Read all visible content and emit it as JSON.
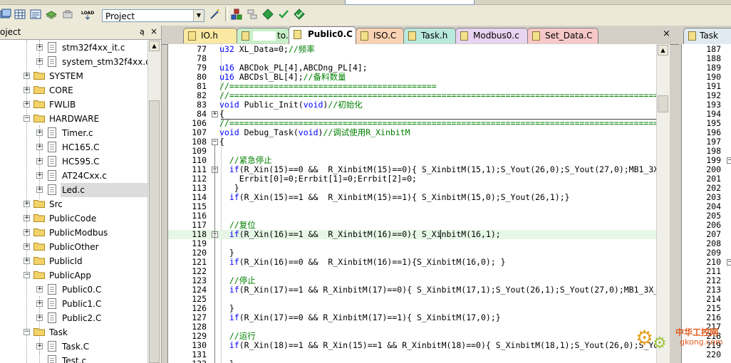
{
  "toolbar": {
    "project_select": "Project"
  },
  "project_panel": {
    "title": "oject",
    "pin": "ą",
    "close": "×",
    "items": [
      {
        "label": "stm32f4xx_it.c",
        "type": "file",
        "level": 3,
        "expander": "+"
      },
      {
        "label": "system_stm32f4xx.c",
        "type": "file",
        "level": 3,
        "expander": "+"
      },
      {
        "label": "SYSTEM",
        "type": "folder",
        "level": 2,
        "expander": "+"
      },
      {
        "label": "CORE",
        "type": "folder",
        "level": 2,
        "expander": "+"
      },
      {
        "label": "FWLIB",
        "type": "folder",
        "level": 2,
        "expander": "+"
      },
      {
        "label": "HARDWARE",
        "type": "folder",
        "level": 2,
        "expander": "−"
      },
      {
        "label": "Timer.c",
        "type": "file",
        "level": 3,
        "expander": "+"
      },
      {
        "label": "HC165.C",
        "type": "file",
        "level": 3,
        "expander": "+"
      },
      {
        "label": "HC595.C",
        "type": "file",
        "level": 3,
        "expander": "+"
      },
      {
        "label": "AT24Cxx.c",
        "type": "file",
        "level": 3,
        "expander": "+"
      },
      {
        "label": "Led.c",
        "type": "file",
        "level": 3,
        "expander": "+",
        "selected": true
      },
      {
        "label": "Src",
        "type": "folder",
        "level": 2,
        "expander": "+"
      },
      {
        "label": "PublicCode",
        "type": "folder",
        "level": 2,
        "expander": "+"
      },
      {
        "label": "PublicModbus",
        "type": "folder",
        "level": 2,
        "expander": "+"
      },
      {
        "label": "PublicOther",
        "type": "folder",
        "level": 2,
        "expander": "+"
      },
      {
        "label": "PublicId",
        "type": "folder",
        "level": 2,
        "expander": "+"
      },
      {
        "label": "PublicApp",
        "type": "folder",
        "level": 2,
        "expander": "−"
      },
      {
        "label": "Public0.C",
        "type": "file",
        "level": 3,
        "expander": "+"
      },
      {
        "label": "Public1.C",
        "type": "file",
        "level": 3,
        "expander": "+"
      },
      {
        "label": "Public2.C",
        "type": "file",
        "level": 3,
        "expander": "+"
      },
      {
        "label": "Task",
        "type": "folder",
        "level": 2,
        "expander": "−"
      },
      {
        "label": "Task.C",
        "type": "file",
        "level": 3,
        "expander": "+"
      },
      {
        "label": "Test.c",
        "type": "file",
        "level": 3,
        "expander": ""
      }
    ]
  },
  "editor": {
    "tabs": [
      {
        "label": "IO.h",
        "color": "#f9e9a3",
        "active": false
      },
      {
        "label": "to.C",
        "color": "#c8f0c8",
        "active": false,
        "masked": true
      },
      {
        "label": "Public0.C",
        "color": "#ffffff",
        "active": true
      },
      {
        "label": "ISO.C",
        "color": "#f9d3b3",
        "active": false
      },
      {
        "label": "Task.h",
        "color": "#b9e8dc",
        "active": false
      },
      {
        "label": "Modbus0.c",
        "color": "#e8d3f0",
        "active": false
      },
      {
        "label": "Set_Data.C",
        "color": "#f6c8c8",
        "active": false
      }
    ],
    "close": "×",
    "lines": [
      {
        "n": "77",
        "text": "u32 XL_Data=0;//频率"
      },
      {
        "n": "78",
        "text": ""
      },
      {
        "n": "79",
        "text": "u16 ABCDok_PL[4],ABCDng_PL[4];"
      },
      {
        "n": "80",
        "text": "u16 ABCDsl_BL[4];//备料数量"
      },
      {
        "n": "81",
        "text": "//=========================================="
      },
      {
        "n": "82",
        "text": "//=================================================================================================="
      },
      {
        "n": "83",
        "text": "void Public_Init(void)//初始化"
      },
      {
        "n": "84",
        "text": "{"
      },
      {
        "n": "106",
        "text": "//=================================================================================================="
      },
      {
        "n": "107",
        "text": "void Debug_Task(void)//调试使用R_XinbitM"
      },
      {
        "n": "108",
        "text": "{"
      },
      {
        "n": "109",
        "text": ""
      },
      {
        "n": "110",
        "text": "  //紧急停止"
      },
      {
        "n": "111",
        "text": "  if(R_Xin(15)==0 &&  R_XinbitM(15)==0){ S_XinbitM(15,1);S_Yout(26,0);S_Yout(27,0);MB1_3X"
      },
      {
        "n": "112",
        "text": "    Errbit[0]=0;Errbit[1]=0;Errbit[2]=0;"
      },
      {
        "n": "113",
        "text": "   }"
      },
      {
        "n": "114",
        "text": "  if(R_Xin(15)==1 &&  R_XinbitM(15)==1){ S_XinbitM(15,0);S_Yout(26,1);}"
      },
      {
        "n": "115",
        "text": ""
      },
      {
        "n": "116",
        "text": ""
      },
      {
        "n": "117",
        "text": "  //复位"
      },
      {
        "n": "118",
        "text": "  if(R_Xin(16)==1 &&  R_XinbitM(16)==0){ S_XinbitM(16,1);"
      },
      {
        "n": "119",
        "text": ""
      },
      {
        "n": "120",
        "text": "  }"
      },
      {
        "n": "121",
        "text": "  if(R_Xin(16)==0 &&  R_XinbitM(16)==1){S_XinbitM(16,0); }"
      },
      {
        "n": "122",
        "text": ""
      },
      {
        "n": "123",
        "text": "  //停止"
      },
      {
        "n": "124",
        "text": "  if(R_Xin(17)==1 && R_XinbitM(17)==0){ S_XinbitM(17,1);S_Yout(26,1);S_Yout(27,0);MB1_3X_"
      },
      {
        "n": "125",
        "text": ""
      },
      {
        "n": "126",
        "text": "  }"
      },
      {
        "n": "127",
        "text": "  if(R_Xin(17)==0 && R_XinbitM(17)==1){ S_XinbitM(17,0);}"
      },
      {
        "n": "128",
        "text": ""
      },
      {
        "n": "129",
        "text": "  //运行"
      },
      {
        "n": "130",
        "text": "  if(R_Xin(18)==1 && R_Xin(15)==1 && R_XinbitM(18)==0){ S_XinbitM(18,1);S_Yout(26,0);S_Yo"
      },
      {
        "n": "131",
        "text": ""
      },
      {
        "n": "132",
        "text": "  }"
      }
    ]
  },
  "right_pane": {
    "tab_label": "Task",
    "line_numbers": [
      "187",
      "188",
      "189",
      "190",
      "191",
      "192",
      "193",
      "194",
      "195",
      "196",
      "197",
      "198",
      "199",
      "200",
      "201",
      "202",
      "203",
      "204",
      "205",
      "206",
      "207",
      "208",
      "209",
      "210",
      "211",
      "212",
      "213",
      "214",
      "215",
      "216",
      "217",
      "218",
      "219",
      "220"
    ]
  },
  "watermark": {
    "line1": "中华工控网",
    "line2": "gkong.com"
  }
}
